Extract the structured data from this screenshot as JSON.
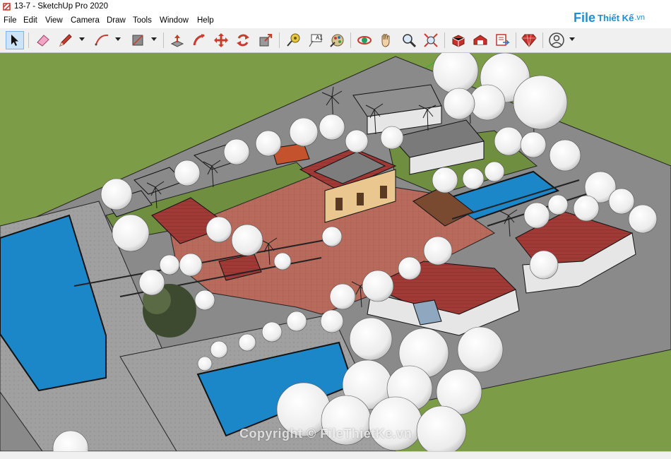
{
  "window": {
    "title": "13-7 - SketchUp Pro 2020"
  },
  "menu": [
    {
      "label": "File"
    },
    {
      "label": "Edit"
    },
    {
      "label": "View"
    },
    {
      "label": "Camera"
    },
    {
      "label": "Draw"
    },
    {
      "label": "Tools"
    },
    {
      "label": "Window"
    },
    {
      "label": "Help"
    }
  ],
  "toolbar": {
    "tools": [
      "select-icon",
      "eraser-icon",
      "pencil-line-icon",
      "arc-icon",
      "rectangle-icon",
      "push-pull-icon",
      "follow-me-icon",
      "move-icon",
      "rotate-icon",
      "scale-icon",
      "tape-measure-icon",
      "text-icon",
      "paint-bucket-icon",
      "orbit-icon",
      "pan-icon",
      "zoom-icon",
      "zoom-extents-icon",
      "3d-warehouse-icon",
      "extension-warehouse-icon",
      "layout-icon",
      "extension-manager-icon",
      "account-icon"
    ],
    "text_tool_label": "A1"
  },
  "brand": {
    "name": "File",
    "name2": "Thiết Kế",
    "suffix": ".vn"
  },
  "watermark": "Copyright © FileThietKe.vn",
  "colors": {
    "grass": "#7a9a46",
    "plaza": "#b8655a",
    "water": "#1b86c8",
    "road": "#9a9a9a",
    "roof": "#9c3a38"
  }
}
